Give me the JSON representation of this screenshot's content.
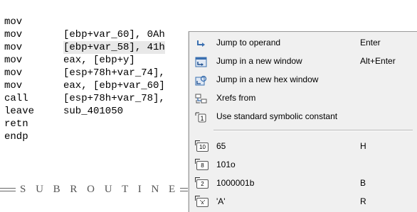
{
  "listing": {
    "lines": [
      {
        "mnemonic": "mov",
        "operand": "[ebp+var_60], 0Ah"
      },
      {
        "mnemonic": "mov",
        "operand": "[ebp+var_58], 41h"
      },
      {
        "mnemonic": "mov",
        "operand": "eax, [ebp+y]"
      },
      {
        "mnemonic": "mov",
        "operand": "[esp+78h+var_74],"
      },
      {
        "mnemonic": "mov",
        "operand": "eax, [ebp+var_60]"
      },
      {
        "mnemonic": "mov",
        "operand": "[esp+78h+var_78],"
      },
      {
        "mnemonic": "call",
        "operand": "sub_401050"
      },
      {
        "mnemonic": "leave",
        "operand": ""
      },
      {
        "mnemonic": "retn",
        "operand": ""
      },
      {
        "mnemonic": "endp",
        "operand": ""
      }
    ],
    "separator": "S U B R O U T I N E"
  },
  "context_menu": {
    "items": [
      {
        "icon": "jump-operand-icon",
        "label": "Jump to operand",
        "shortcut": "Enter"
      },
      {
        "icon": "new-window-icon",
        "label": "Jump in a new window",
        "shortcut": "Alt+Enter"
      },
      {
        "icon": "hex-window-icon",
        "label": "Jump in a new hex window",
        "shortcut": ""
      },
      {
        "icon": "xrefs-icon",
        "label": "Xrefs from",
        "shortcut": ""
      },
      {
        "icon": "symbolic-const-icon",
        "label": "Use standard symbolic constant",
        "shortcut": ""
      }
    ],
    "format_items": [
      {
        "icon": "decimal-icon",
        "badge": "10",
        "label": "65",
        "shortcut": "H"
      },
      {
        "icon": "octal-icon",
        "badge": "8",
        "label": "101o",
        "shortcut": ""
      },
      {
        "icon": "binary-icon",
        "badge": "2",
        "label": "1000001b",
        "shortcut": "B"
      },
      {
        "icon": "char-icon",
        "badge": "'x'",
        "label": "'A'",
        "shortcut": "R"
      }
    ]
  },
  "colors": {
    "menu_bg": "#f0f0f0",
    "icon_blue": "#3a6fb0",
    "highlight": "#e8e8e8"
  }
}
